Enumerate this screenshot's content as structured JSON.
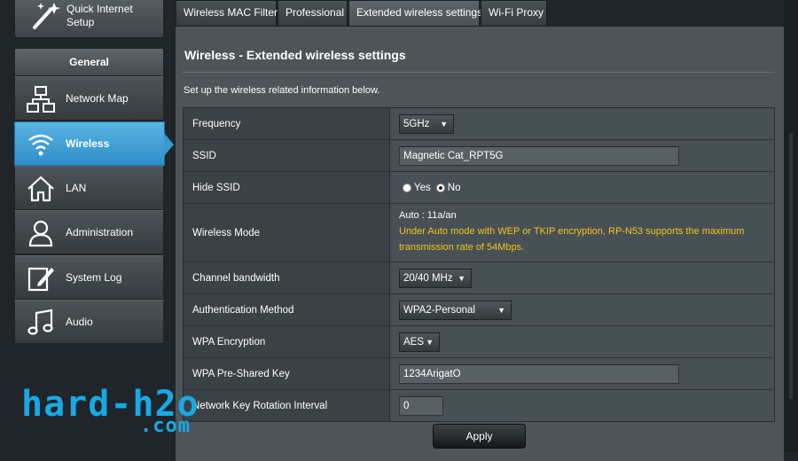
{
  "sidebar": {
    "quick_setup_label": "Quick Internet Setup",
    "general_header": "General",
    "items": [
      {
        "label": "Network Map",
        "icon": "network-map-icon"
      },
      {
        "label": "Wireless",
        "icon": "wifi-icon"
      },
      {
        "label": "LAN",
        "icon": "home-icon"
      },
      {
        "label": "Administration",
        "icon": "user-icon"
      },
      {
        "label": "System Log",
        "icon": "log-edit-icon"
      },
      {
        "label": "Audio",
        "icon": "music-note-icon"
      }
    ],
    "active_item": "Wireless"
  },
  "tabs": [
    "Wireless MAC Filter",
    "Professional",
    "Extended wireless settings",
    "Wi-Fi Proxy"
  ],
  "active_tab": "Extended wireless settings",
  "main": {
    "title": "Wireless - Extended wireless settings",
    "description": "Set up the wireless related information below.",
    "rows": {
      "frequency": {
        "label": "Frequency",
        "value": "5GHz"
      },
      "ssid": {
        "label": "SSID",
        "value": "Magnetic Cat_RPT5G"
      },
      "hide_ssid": {
        "label": "Hide SSID",
        "yes": "Yes",
        "no": "No",
        "selected": "No"
      },
      "wireless_mode": {
        "label": "Wireless Mode",
        "value": "Auto : 11a/an",
        "warning_line1": "Under Auto mode with WEP or TKIP encryption, RP-N53 supports the maximum",
        "warning_line2": "transmission rate of 54Mbps."
      },
      "channel_bandwidth": {
        "label": "Channel bandwidth",
        "value": "20/40 MHz"
      },
      "auth_method": {
        "label": "Authentication Method",
        "value": "WPA2-Personal"
      },
      "wpa_encryption": {
        "label": "WPA Encryption",
        "value": "AES"
      },
      "wpa_psk": {
        "label": "WPA Pre-Shared Key",
        "value": "1234ArigatO"
      },
      "key_rotation": {
        "label": "Network Key Rotation Interval",
        "value": "0"
      }
    },
    "apply_label": "Apply"
  },
  "watermark": {
    "main": "hard-h2o",
    "sub": ".com"
  },
  "colors": {
    "accent": "#3a98d0",
    "warning": "#f5c518",
    "watermark": "#19a8e6"
  }
}
